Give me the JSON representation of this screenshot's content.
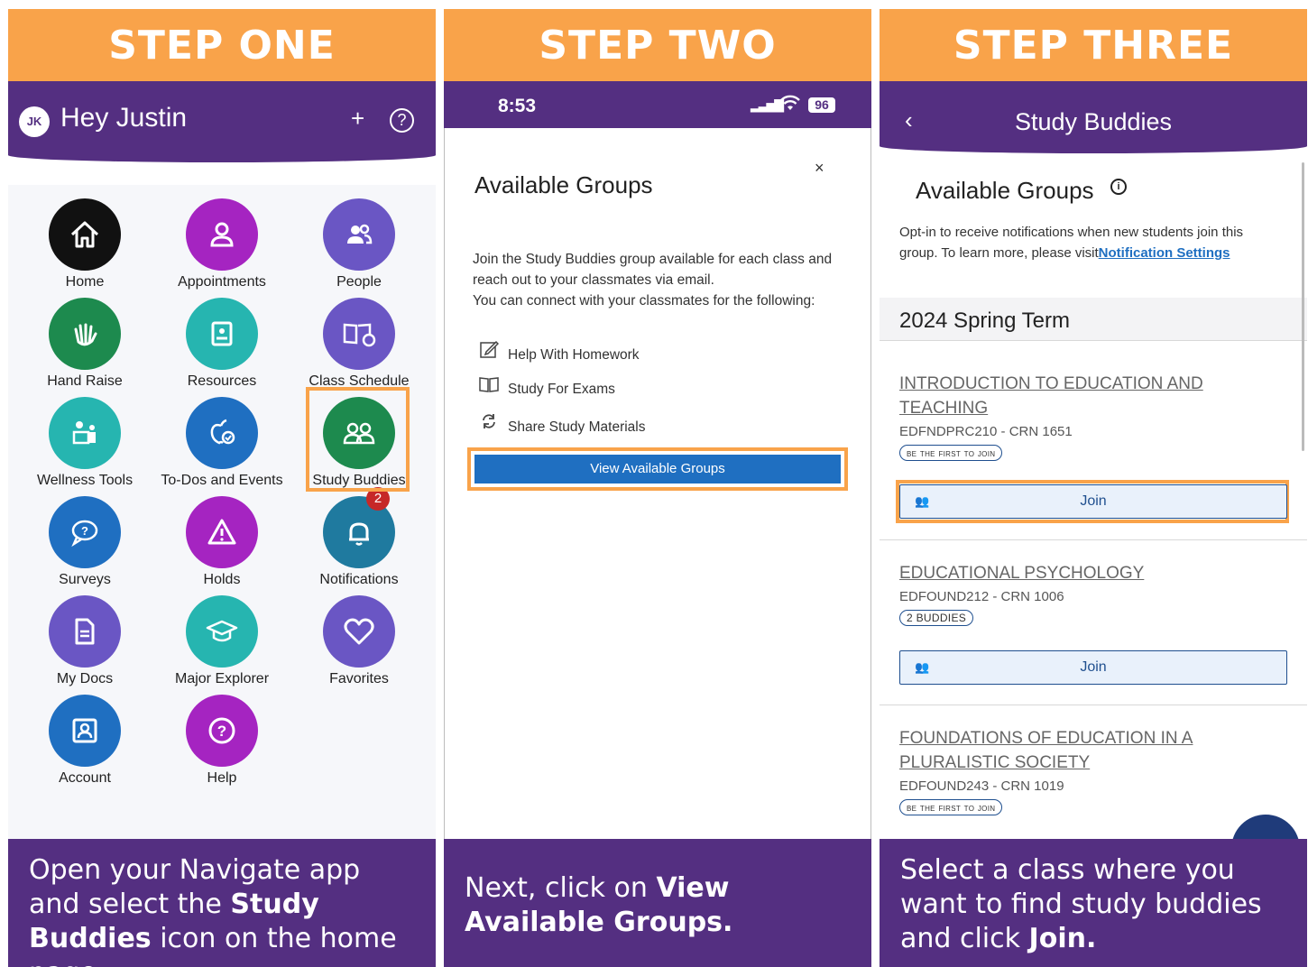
{
  "colors": {
    "orange": "#f9a34a",
    "purple": "#542f81",
    "primary_blue": "#1f6fc1"
  },
  "step1": {
    "banner": "STEP ONE",
    "header": {
      "avatar": "JK",
      "greeting": "Hey Justin",
      "plus": "+",
      "help": "?"
    },
    "tiles": [
      {
        "label": "Home",
        "icon": "home-icon",
        "color": "#111111"
      },
      {
        "label": "Appointments",
        "icon": "person-icon",
        "color": "#a524c1"
      },
      {
        "label": "People",
        "icon": "people-icon",
        "color": "#6a56c4"
      },
      {
        "label": "Hand Raise",
        "icon": "hand-raise-icon",
        "color": "#1d8a4e"
      },
      {
        "label": "Resources",
        "icon": "resources-icon",
        "color": "#26b5b0"
      },
      {
        "label": "Class Schedule",
        "icon": "class-schedule-icon",
        "color": "#6a56c4"
      },
      {
        "label": "Wellness Tools",
        "icon": "wellness-icon",
        "color": "#26b5b0"
      },
      {
        "label": "To-Dos and Events",
        "icon": "apple-check-icon",
        "color": "#1f6fc1"
      },
      {
        "label": "Study Buddies",
        "icon": "study-buddies-icon",
        "color": "#1d8a4e"
      },
      {
        "label": "Surveys",
        "icon": "survey-icon",
        "color": "#1f6fc1"
      },
      {
        "label": "Holds",
        "icon": "warning-icon",
        "color": "#a524c1"
      },
      {
        "label": "Notifications",
        "icon": "bell-icon",
        "color": "#1f7a9f",
        "badge": "2"
      },
      {
        "label": "My Docs",
        "icon": "document-icon",
        "color": "#6a56c4"
      },
      {
        "label": "Major Explorer",
        "icon": "graduation-cap-icon",
        "color": "#26b5b0"
      },
      {
        "label": "Favorites",
        "icon": "heart-icon",
        "color": "#6a56c4"
      },
      {
        "label": "Account",
        "icon": "account-icon",
        "color": "#1f6fc1"
      },
      {
        "label": "Help",
        "icon": "help-icon",
        "color": "#a524c1"
      }
    ],
    "instruction_parts": [
      "Open your Navigate app and select the ",
      "Study Buddies",
      " icon on the home page."
    ]
  },
  "step2": {
    "banner": "STEP TWO",
    "status": {
      "time": "8:53",
      "battery": "96"
    },
    "close": "×",
    "title": "Available Groups",
    "desc_lines": [
      "Join the Study Buddies group available for each class and reach out to your classmates via email.",
      "You can connect with your classmates for the following:"
    ],
    "features": [
      {
        "icon": "pencil-icon",
        "label": "Help With Homework"
      },
      {
        "icon": "book-icon",
        "label": "Study For Exams"
      },
      {
        "icon": "sync-icon",
        "label": "Share Study Materials"
      }
    ],
    "button": "View Available Groups",
    "instruction_parts": [
      "Next, click on ",
      "View Available Groups."
    ]
  },
  "step3": {
    "banner": "STEP THREE",
    "header_title": "Study Buddies",
    "back": "‹",
    "section_title": "Available Groups",
    "info": "i",
    "optin_text": "Opt-in to receive notifications when new students join this group. To learn more, please visit",
    "optin_link": "Notification Settings",
    "term": "2024 Spring Term",
    "courses": [
      {
        "name": "Introduction to Education and Teaching",
        "code": "EDFNDPRC210 - CRN 1651",
        "pill": "Be the first to join",
        "join": "Join"
      },
      {
        "name": "Educational Psychology",
        "code": "EDFOUND212 - CRN 1006",
        "pill": "2 buddies",
        "join": "Join"
      },
      {
        "name": "Foundations of Education in a Pluralistic Society",
        "code": "EDFOUND243 - CRN 1019",
        "pill": "Be the first to join"
      }
    ],
    "instruction_parts": [
      "Select a class where you want to find study buddies and click ",
      "Join."
    ]
  }
}
